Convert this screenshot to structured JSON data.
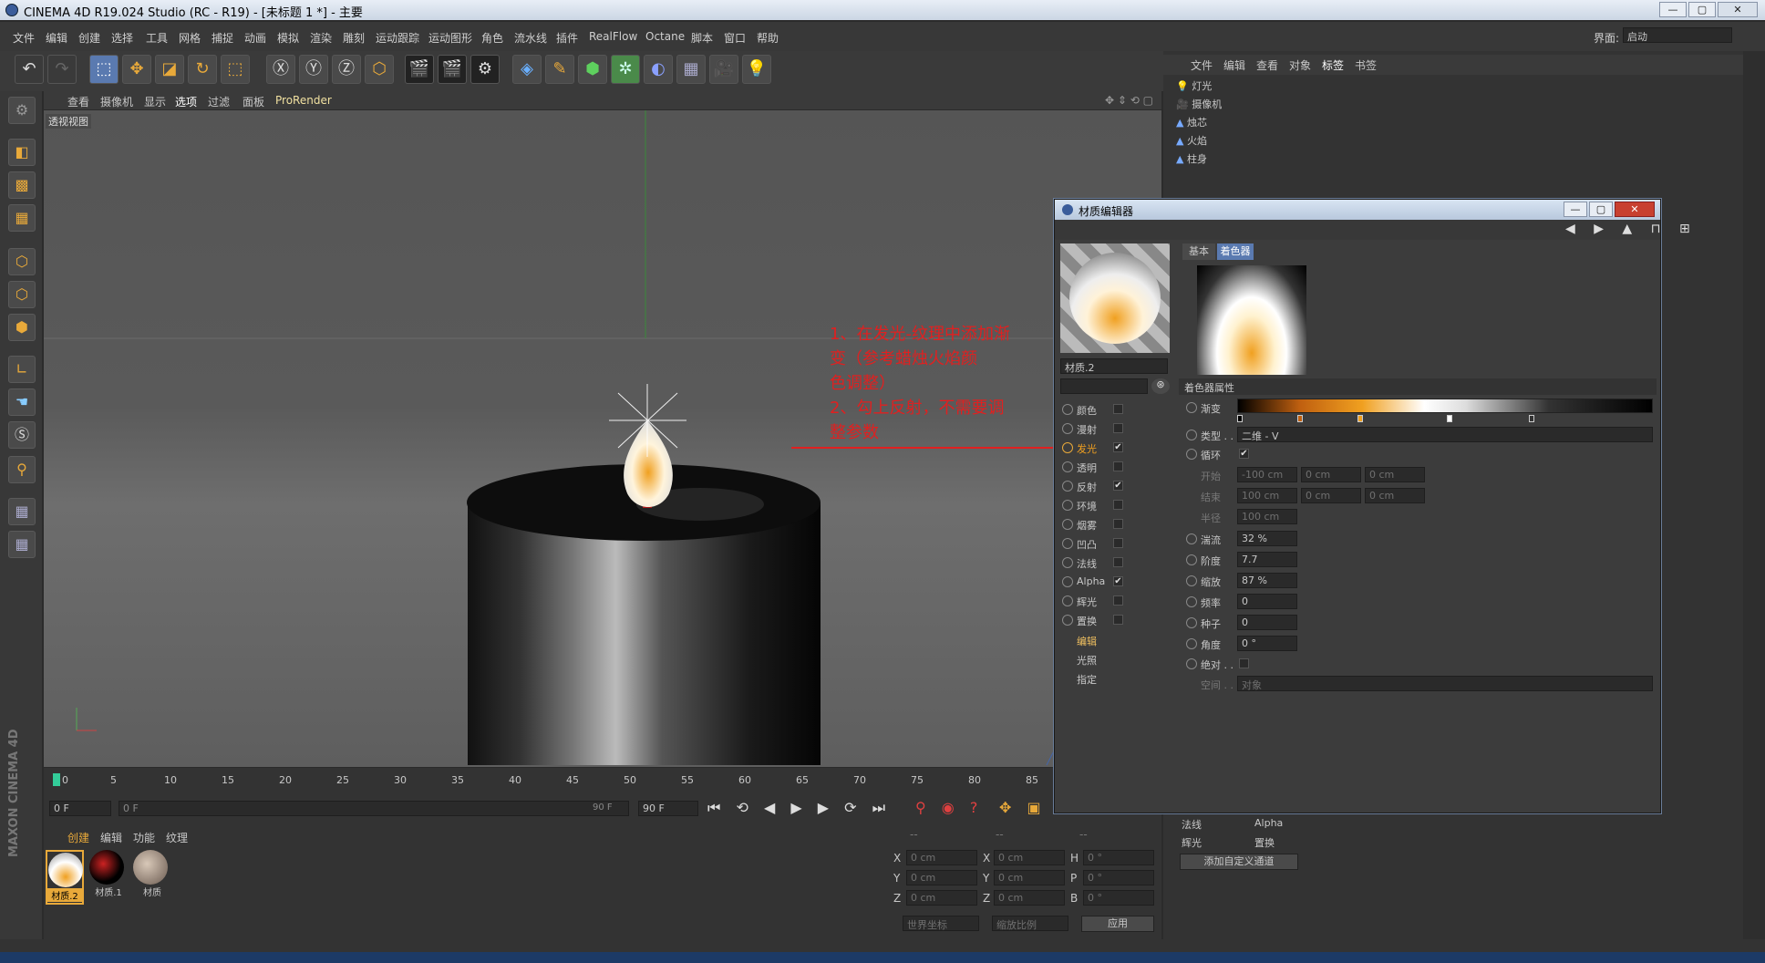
{
  "window": {
    "title": "CINEMA 4D R19.024 Studio (RC - R19) - [未标题 1 *] - 主要",
    "btn_min": "—",
    "btn_max": "▢",
    "btn_close": "✕"
  },
  "menu": [
    "文件",
    "编辑",
    "创建",
    "选择",
    "工具",
    "网格",
    "捕捉",
    "动画",
    "模拟",
    "渲染",
    "雕刻",
    "运动跟踪",
    "运动图形",
    "角色",
    "流水线",
    "插件",
    "RealFlow",
    "Octane",
    "脚本",
    "窗口",
    "帮助"
  ],
  "layout": {
    "label": "界面:",
    "value": "启动"
  },
  "viewport": {
    "menu": [
      "查看",
      "摄像机",
      "显示",
      "选项",
      "过滤",
      "面板",
      "ProRender"
    ],
    "label": "透视视图"
  },
  "annotation": {
    "line1": "1、在发光-纹理中添加渐",
    "line2": "变（参考蜡烛火焰颜",
    "line3": "色调整）",
    "line4": "2、勾上反射，不需要调",
    "line5": "整参数"
  },
  "timeline": {
    "ticks": [
      "0",
      "5",
      "10",
      "15",
      "20",
      "25",
      "30",
      "35",
      "40",
      "45",
      "50",
      "55",
      "60",
      "65",
      "70",
      "75",
      "80",
      "85"
    ],
    "current": "0 F",
    "range_start": "0 F",
    "range_end": "90 F",
    "end": "90 F"
  },
  "matbar": {
    "menu": [
      "创建",
      "编辑",
      "功能",
      "纹理"
    ],
    "materials": [
      "材质.2",
      "材质.1",
      "材质"
    ]
  },
  "coords": {
    "heads": [
      "--",
      "--",
      "--"
    ],
    "rows": [
      {
        "a": "X",
        "av": "0 cm",
        "b": "X",
        "bv": "0 cm",
        "c": "H",
        "cv": "0 °"
      },
      {
        "a": "Y",
        "av": "0 cm",
        "b": "Y",
        "bv": "0 cm",
        "c": "P",
        "cv": "0 °"
      },
      {
        "a": "Z",
        "av": "0 cm",
        "b": "Z",
        "bv": "0 cm",
        "c": "B",
        "cv": "0 °"
      }
    ],
    "world": "世界坐标",
    "scale": "缩放比例",
    "apply": "应用"
  },
  "objmgr": {
    "menu": [
      "文件",
      "编辑",
      "查看",
      "对象",
      "标签",
      "书签"
    ],
    "objects": [
      "灯光",
      "摄像机",
      "烛芯",
      "火焰",
      "柱身"
    ]
  },
  "attr_bottom": {
    "normal": "法线",
    "alpha": "Alpha",
    "glow": "辉光",
    "disp": "置换",
    "add": "添加自定义通道"
  },
  "dialog": {
    "title": "材质编辑器",
    "mat_name": "材质.2",
    "tabs": [
      "基本",
      "着色器"
    ],
    "section": "着色器属性",
    "channels": [
      {
        "name": "颜色",
        "checked": ""
      },
      {
        "name": "漫射",
        "checked": ""
      },
      {
        "name": "发光",
        "checked": "✔"
      },
      {
        "name": "透明",
        "checked": ""
      },
      {
        "name": "反射",
        "checked": "✔"
      },
      {
        "name": "环境",
        "checked": ""
      },
      {
        "name": "烟雾",
        "checked": ""
      },
      {
        "name": "凹凸",
        "checked": ""
      },
      {
        "name": "法线",
        "checked": ""
      },
      {
        "name": "Alpha",
        "checked": "✔"
      },
      {
        "name": "辉光",
        "checked": ""
      },
      {
        "name": "置换",
        "checked": ""
      }
    ],
    "extra": [
      "编辑",
      "光照",
      "指定"
    ],
    "props": {
      "gradient": "渐变",
      "type_label": "类型 . .",
      "type_value": "二维 - V",
      "cycle": "循环",
      "cycle_check": "✔",
      "start": "开始",
      "start_v": [
        "-100 cm",
        "0 cm",
        "0 cm"
      ],
      "end": "结束",
      "end_v": [
        "100 cm",
        "0 cm",
        "0 cm"
      ],
      "radius": "半径",
      "radius_v": "100 cm",
      "turb": "湍流",
      "turb_v": "32 %",
      "octaves": "阶度",
      "octaves_v": "7.7",
      "scale": "缩放",
      "scale_v": "87 %",
      "freq": "频率",
      "freq_v": "0",
      "seed": "种子",
      "seed_v": "0",
      "angle": "角度",
      "angle_v": "0 °",
      "absolute": "绝对 . .",
      "space": "空间 . .",
      "space_v": "对象"
    }
  },
  "colors": {
    "accent": "#f0a020",
    "annot": "#e02020",
    "panel": "#3c3c3c"
  }
}
